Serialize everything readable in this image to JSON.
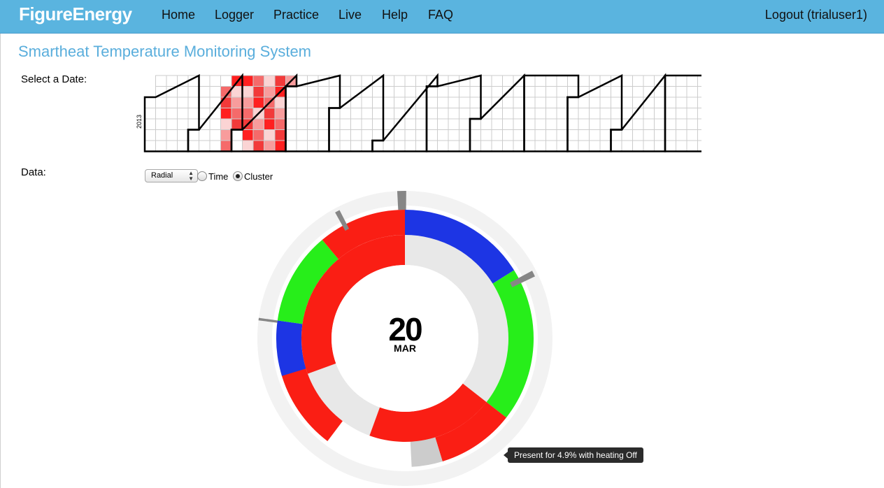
{
  "nav": {
    "brand": "FigureEnergy",
    "items": [
      "Home",
      "Logger",
      "Practice",
      "Live",
      "Help",
      "FAQ"
    ],
    "logout": "Logout (trialuser1)"
  },
  "page": {
    "title": "Smartheat Temperature Monitoring System",
    "select_date_label": "Select a Date:",
    "data_label": "Data:"
  },
  "calendar": {
    "year_label": "2013",
    "selected_day": "20",
    "highlight_color": "#ff2020"
  },
  "controls": {
    "view_select": {
      "selected": "Radial"
    },
    "radios": [
      {
        "label": "Time",
        "checked": false
      },
      {
        "label": "Cluster",
        "checked": true
      }
    ]
  },
  "radial": {
    "date_day": "20",
    "date_month": "MAR",
    "colors": {
      "red": "#fa1e14",
      "green": "#27ee1a",
      "blue": "#1d35e4",
      "gray": "#868686",
      "light_gray": "#e8e8e8",
      "track": "#f2f2f2"
    }
  },
  "tooltip": {
    "text": "Present for 4.9% with heating Off"
  }
}
